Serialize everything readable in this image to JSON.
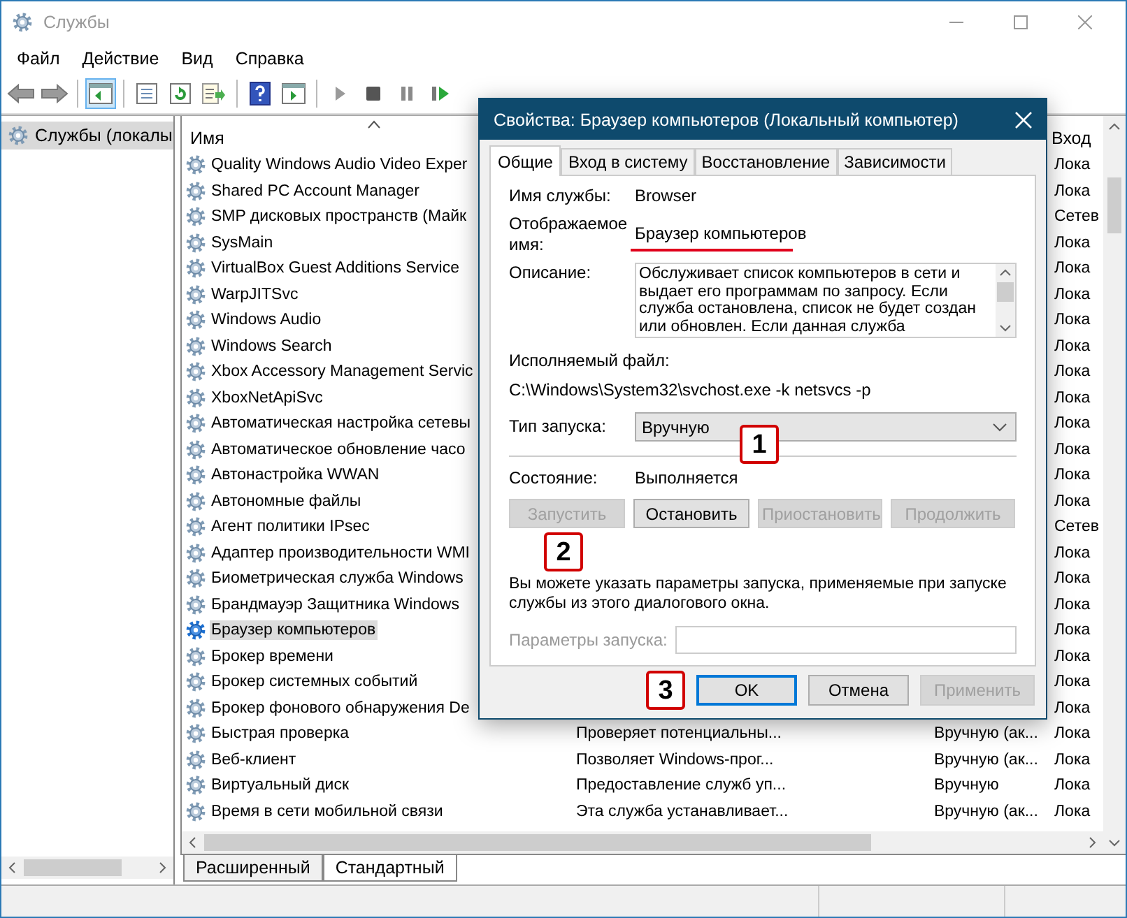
{
  "window": {
    "title": "Службы"
  },
  "menu": [
    "Файл",
    "Действие",
    "Вид",
    "Справка"
  ],
  "toolbar": [
    [
      {
        "kind": "back",
        "pressed": false
      },
      {
        "kind": "forward",
        "pressed": false
      }
    ],
    [
      {
        "kind": "tree",
        "pressed": true
      }
    ],
    [
      {
        "kind": "properties",
        "pressed": false
      },
      {
        "kind": "refresh",
        "pressed": false
      },
      {
        "kind": "export",
        "pressed": false
      }
    ],
    [
      {
        "kind": "help",
        "pressed": false
      },
      {
        "kind": "console",
        "pressed": false
      }
    ],
    [
      {
        "kind": "play",
        "pressed": false
      },
      {
        "kind": "stop",
        "pressed": false
      },
      {
        "kind": "pause",
        "pressed": false
      },
      {
        "kind": "restart",
        "pressed": false
      }
    ]
  ],
  "sidebar": {
    "items": [
      {
        "label": "Службы (локалы",
        "selected": true
      }
    ]
  },
  "table": {
    "columns": {
      "name": "Имя",
      "log_on": "Вход"
    },
    "rows": [
      {
        "name": "Quality Windows Audio Video Exper",
        "log_on": "Лока",
        "selected": false
      },
      {
        "name": "Shared PC Account Manager",
        "log_on": "Лока",
        "selected": false
      },
      {
        "name": "SMP дисковых пространств (Майк",
        "log_on": "Сетев",
        "selected": false
      },
      {
        "name": "SysMain",
        "log_on": "Лока",
        "selected": false
      },
      {
        "name": "VirtualBox Guest Additions Service",
        "log_on": "Лока",
        "selected": false
      },
      {
        "name": "WarpJITSvc",
        "log_on": "Лока",
        "selected": false
      },
      {
        "name": "Windows Audio",
        "log_on": "Лока",
        "selected": false
      },
      {
        "name": "Windows Search",
        "log_on": "Лока",
        "selected": false
      },
      {
        "name": "Xbox Accessory Management Servic",
        "log_on": "Лока",
        "selected": false
      },
      {
        "name": "XboxNetApiSvc",
        "log_on": "Лока",
        "selected": false
      },
      {
        "name": "Автоматическая настройка сетевы",
        "log_on": "Лока",
        "selected": false
      },
      {
        "name": "Автоматическое обновление часо",
        "log_on": "Лока",
        "selected": false
      },
      {
        "name": "Автонастройка WWAN",
        "log_on": "Лока",
        "selected": false
      },
      {
        "name": "Автономные файлы",
        "log_on": "Лока",
        "selected": false
      },
      {
        "name": "Агент политики IPsec",
        "log_on": "Сетев",
        "selected": false
      },
      {
        "name": "Адаптер производительности WMI",
        "log_on": "Лока",
        "selected": false
      },
      {
        "name": "Биометрическая служба Windows",
        "log_on": "Лока",
        "selected": false
      },
      {
        "name": "Брандмауэр Защитника Windows",
        "log_on": "Лока",
        "selected": false
      },
      {
        "name": "Браузер компьютеров",
        "log_on": "Лока",
        "selected": true
      },
      {
        "name": "Брокер времени",
        "log_on": "Лока",
        "selected": false
      },
      {
        "name": "Брокер системных событий",
        "log_on": "Лока",
        "selected": false
      },
      {
        "name": "Брокер фонового обнаружения De",
        "log_on": "Лока",
        "selected": false
      },
      {
        "name": "Быстрая проверка",
        "description": "Проверяет потенциальны...",
        "startup": "Вручную (ак...",
        "log_on": "Лока",
        "selected": false
      },
      {
        "name": "Веб-клиент",
        "description": "Позволяет Windows-прог...",
        "startup": "Вручную (ак...",
        "log_on": "Лока",
        "selected": false
      },
      {
        "name": "Виртуальный диск",
        "description": "Предоставление служб уп...",
        "startup": "Вручную",
        "log_on": "Лока",
        "selected": false
      },
      {
        "name": "Время в сети мобильной связи",
        "description": "Эта служба устанавливает...",
        "startup": "Вручную (ак...",
        "log_on": "Лока",
        "selected": false
      }
    ]
  },
  "view_tabs": [
    {
      "label": "Расширенный",
      "selected": false
    },
    {
      "label": "Стандартный",
      "selected": true
    }
  ],
  "dialog": {
    "title": "Свойства: Браузер компьютеров (Локальный компьютер)",
    "tabs": [
      {
        "label": "Общие",
        "selected": true
      },
      {
        "label": "Вход в систему",
        "selected": false
      },
      {
        "label": "Восстановление",
        "selected": false
      },
      {
        "label": "Зависимости",
        "selected": false
      }
    ],
    "service_name_label": "Имя службы:",
    "service_name": "Browser",
    "display_name_label": "Отображаемое имя:",
    "display_name": "Браузер компьютеров",
    "description_label": "Описание:",
    "description": "Обслуживает список компьютеров в сети и выдает его программам по запросу. Если служба остановлена, список не будет создан или обновлен. Если данная служба",
    "executable_label": "Исполняемый файл:",
    "executable": "C:\\Windows\\System32\\svchost.exe -k netsvcs -p",
    "startup_label": "Тип запуска:",
    "startup_value": "Вручную",
    "status_label": "Состояние:",
    "status_value": "Выполняется",
    "service_buttons": [
      {
        "label": "Запустить",
        "disabled": true
      },
      {
        "label": "Остановить",
        "disabled": false
      },
      {
        "label": "Приостановить",
        "disabled": true
      },
      {
        "label": "Продолжить",
        "disabled": true
      }
    ],
    "hint": "Вы можете указать параметры запуска, применяемые при запуске службы из этого диалогового окна.",
    "params_label": "Параметры запуска:",
    "params_disabled": true,
    "buttons": [
      {
        "label": "OK",
        "disabled": false,
        "focused": true
      },
      {
        "label": "Отмена",
        "disabled": false,
        "focused": false
      },
      {
        "label": "Применить",
        "disabled": true,
        "focused": false
      }
    ]
  },
  "annotations": [
    {
      "label": "1"
    },
    {
      "label": "2"
    },
    {
      "label": "3"
    }
  ]
}
